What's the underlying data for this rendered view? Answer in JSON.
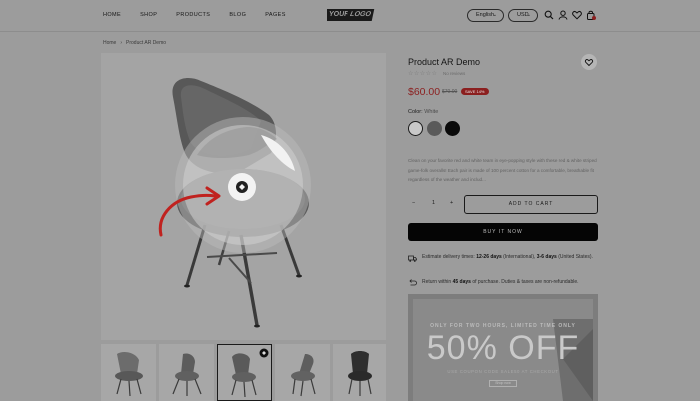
{
  "header": {
    "nav": [
      "HOME",
      "SHOP",
      "PRODUCTS",
      "BLOG",
      "PAGES"
    ],
    "logo_left": "YOUR",
    "logo_right": "LOGO",
    "language": "English",
    "currency": "USD",
    "cart_count": "0"
  },
  "breadcrumb": {
    "home": "Home",
    "separator": "›",
    "current": "Product AR Demo"
  },
  "product": {
    "title": "Product AR Demo",
    "stars": "☆☆☆☆☆",
    "reviews": "No reviews",
    "price": "$60.00",
    "old_price": "$70.00",
    "badge": "SAVE 14%",
    "color_label": "Color:",
    "color_value": "White",
    "swatches": [
      "#c8c8c8",
      "#5a5a5a",
      "#0a0a0a"
    ],
    "description": "Clean on your favorite red and white team in eye-popping style with these red & white striped game-folk overalls! Each pair is made of 100 percent cotton for a comfortable, breathable fit regardless of the weather and includ...",
    "quantity": "1",
    "minus": "−",
    "plus": "+",
    "add_to_cart": "ADD TO CART",
    "buy_now": "BUY IT NOW"
  },
  "delivery": {
    "pre": "Estimate delivery times: ",
    "days1": "12-26 days",
    "mid": " (International), ",
    "days2": "3-6 days",
    "post": " (United States)."
  },
  "returns": {
    "pre": "Return within ",
    "days": "45 days",
    "post": " of purchase. Duties & taxes are non-refundable."
  },
  "promo": {
    "line1": "ONLY FOR TWO HOURS, LIMITED TIME ONLY",
    "line2": "50% OFF",
    "line3": "USE COUPON CODE SALE50 AT CHECKOUT",
    "button": "Shop now"
  }
}
